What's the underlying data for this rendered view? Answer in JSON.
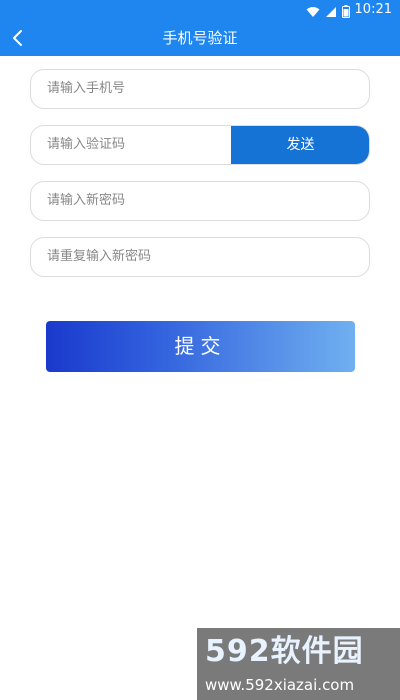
{
  "status_bar": {
    "time": "10:21",
    "icons": [
      "wifi-icon",
      "signal-icon",
      "battery-icon"
    ],
    "color": "#1f86f0"
  },
  "header": {
    "title": "手机号验证",
    "back_icon": "chevron-left-icon"
  },
  "form": {
    "phone_placeholder": "请输入手机号",
    "code_placeholder": "请输入验证码",
    "send_label": "发送",
    "new_password_placeholder": "请输入新密码",
    "repeat_password_placeholder": "请重复输入新密码",
    "submit_label": "提交"
  },
  "watermark": {
    "title": "592软件园",
    "url": "www.592xiazai.com"
  },
  "colors": {
    "accent": "#1f86f0",
    "send_button": "#1573d6",
    "submit_gradient_start": "#1a39cc",
    "submit_gradient_end": "#70b0f0"
  }
}
